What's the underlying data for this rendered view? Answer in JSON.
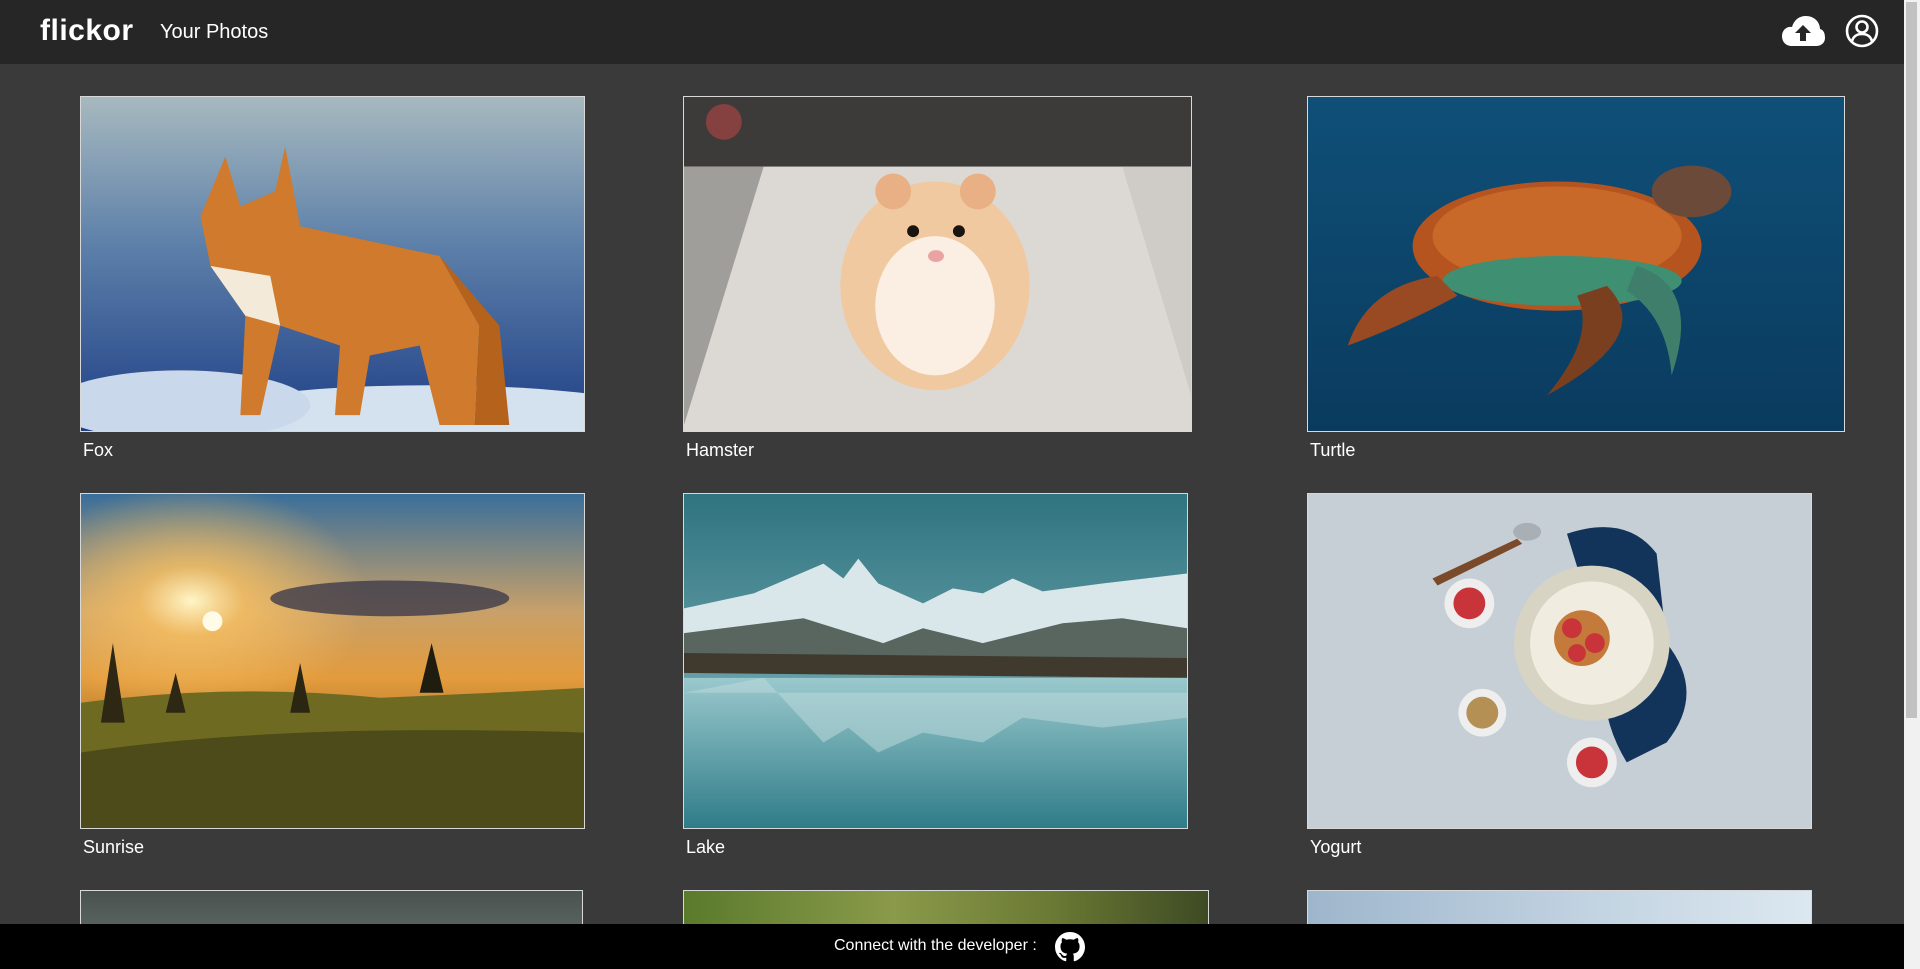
{
  "header": {
    "brand": "flickor",
    "nav_link": "Your Photos",
    "upload_icon": "cloud-upload-icon",
    "account_icon": "user-circle-icon"
  },
  "gallery": {
    "photos": [
      {
        "caption": "Fox"
      },
      {
        "caption": "Hamster"
      },
      {
        "caption": "Turtle"
      },
      {
        "caption": "Sunrise"
      },
      {
        "caption": "Lake"
      },
      {
        "caption": "Yogurt"
      }
    ]
  },
  "footer": {
    "text": "Connect with the developer :",
    "github_icon": "github-icon"
  },
  "colors": {
    "background": "#3a3a3a",
    "header": "#262626",
    "footer": "#000000",
    "text": "#ffffff"
  }
}
